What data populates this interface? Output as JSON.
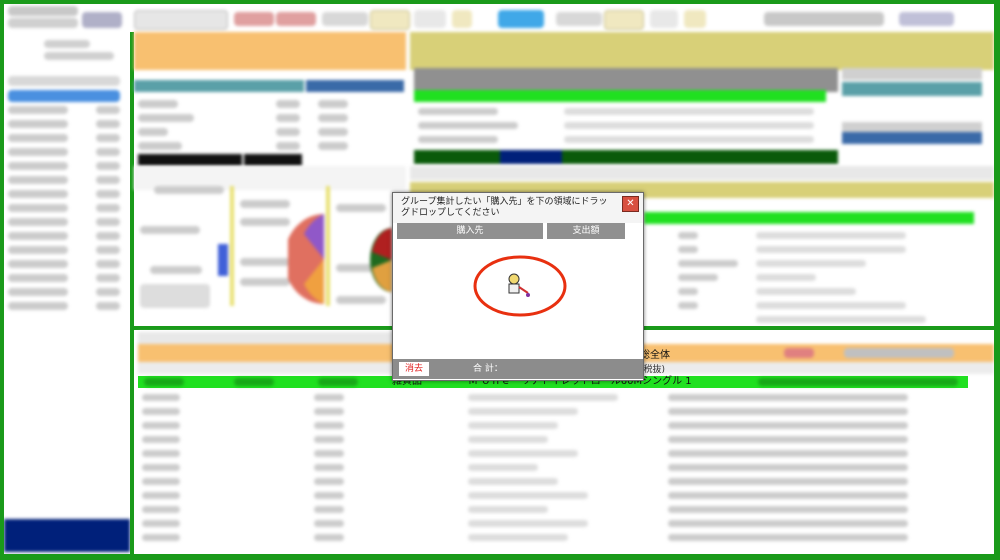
{
  "dialog": {
    "title": "グループ集計したい「購入先」を下の領域にドラッグドロップしてください",
    "column1": "購入先",
    "column2": "支出額",
    "clear_label": "消去",
    "total_label": "合 計："
  },
  "bottom_panel": {
    "tag_label": "総全体",
    "tax_label": "(税抜)"
  },
  "highlight_row": {
    "category": "雑貨品",
    "product": "Ｍ'ｏｎｅ　リナトイレットロール60Mシングル 1"
  },
  "colors": {
    "outer_green": "#1a9a1a",
    "orange_header": "#f8c070",
    "olive_header": "#d8d078",
    "row_green": "#20e020",
    "dark_green_footer": "#0a5a0a",
    "navy": "#00207a",
    "gray_table_header": "#909090",
    "dialog_red_ellipse": "#e83010"
  }
}
